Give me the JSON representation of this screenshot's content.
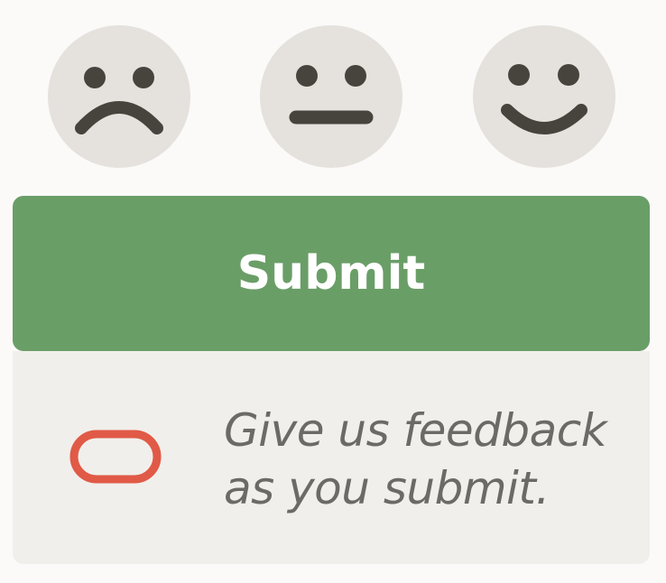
{
  "rating": {
    "faces": [
      {
        "name": "sad",
        "icon": "sad-face-icon"
      },
      {
        "name": "neutral",
        "icon": "neutral-face-icon"
      },
      {
        "name": "happy",
        "icon": "happy-face-icon"
      }
    ]
  },
  "submit": {
    "label": "Submit"
  },
  "feedback": {
    "icon": "oracle-ring-icon",
    "line1": "Give us feedback",
    "line2": "as you submit."
  },
  "colors": {
    "background": "#fbfaf9",
    "face_fill": "#e5e2dd",
    "face_features": "#47443e",
    "submit_bg": "#6a9e67",
    "submit_text": "#ffffff",
    "panel_bg": "#f1efeb",
    "panel_text": "#6c6a67",
    "icon_red": "#e05a47"
  }
}
